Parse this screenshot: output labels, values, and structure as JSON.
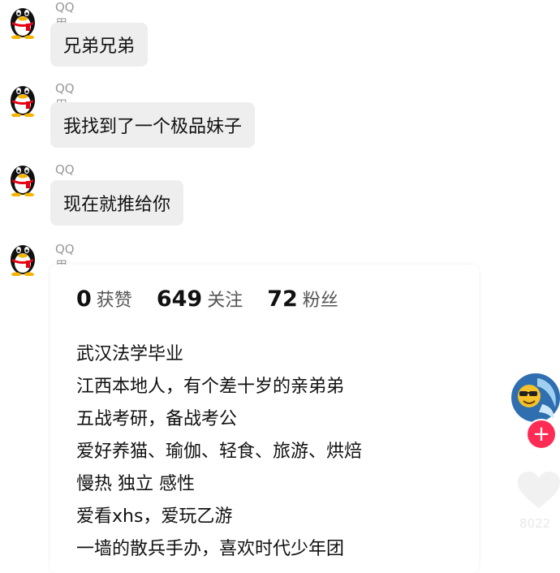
{
  "messages": [
    {
      "sender": "QQ用户",
      "text": "兄弟兄弟"
    },
    {
      "sender": "QQ用户",
      "text": "我找到了一个极品妹子"
    },
    {
      "sender": "QQ用户",
      "text": "现在就推给你"
    },
    {
      "sender": "QQ用户"
    }
  ],
  "profile_card": {
    "stats": [
      {
        "value": "0",
        "label": "获赞"
      },
      {
        "value": "649",
        "label": "关注"
      },
      {
        "value": "72",
        "label": "粉丝"
      }
    ],
    "bio": [
      "武汉法学毕业",
      "江西本地人，有个差十岁的亲弟弟",
      "五战考研，备战考公",
      "爱好养猫、瑜伽、轻食、旅游、烘焙",
      "慢热  独立  感性",
      "爱看xhs，爱玩乙游",
      "一墙的散兵手办，喜欢时代少年团"
    ]
  },
  "side_panel": {
    "follow_label": "+",
    "like_count": "8022"
  },
  "icons": {
    "sender_avatar": "qq-penguin-icon",
    "profile_avatar": "sunglasses-emoji-avatar",
    "like": "heart-icon"
  }
}
